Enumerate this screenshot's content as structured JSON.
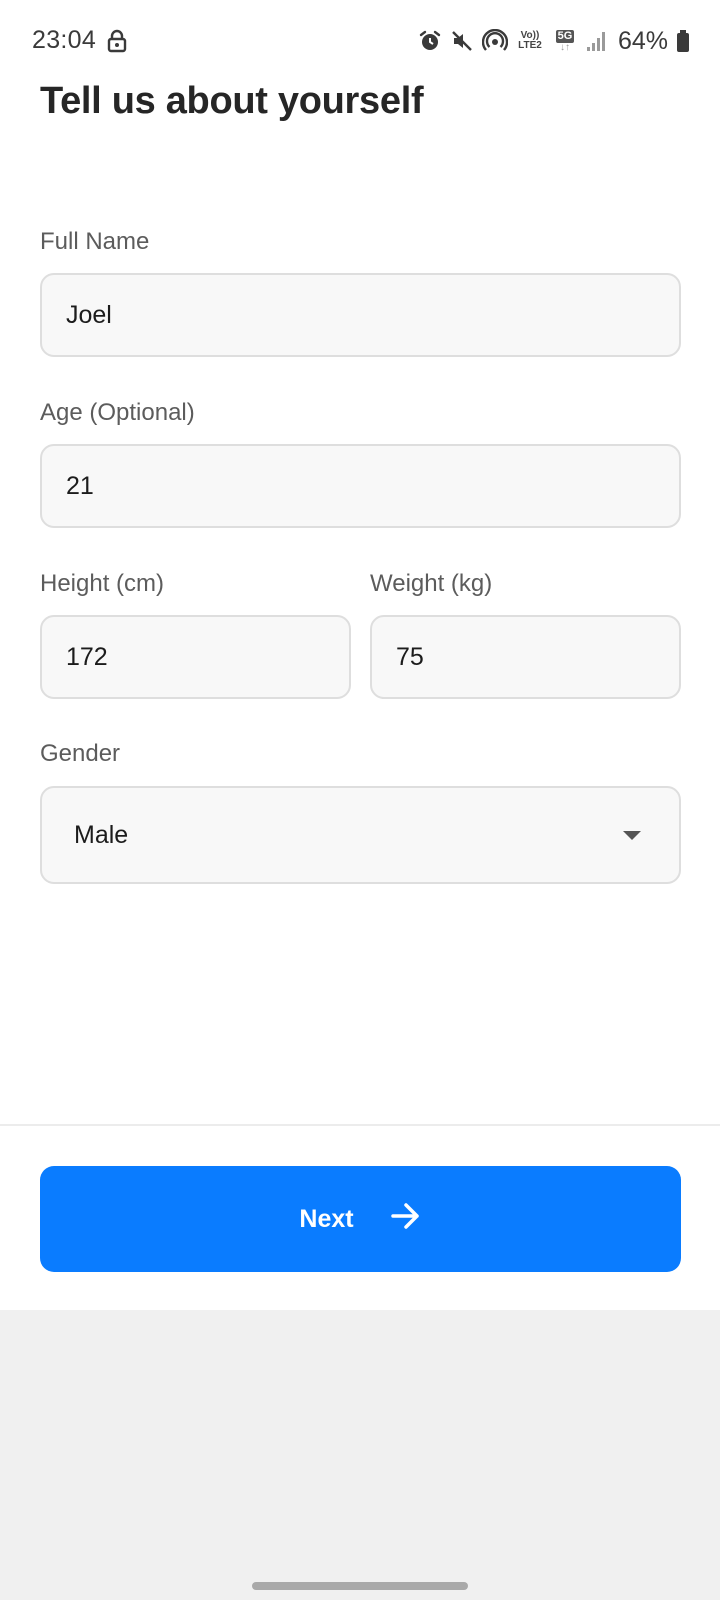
{
  "status_bar": {
    "time": "23:04",
    "network_label_top": "Vo))",
    "network_label_bottom": "LTE2",
    "network_type": "5G",
    "battery": "64%",
    "icons": [
      "lock-icon",
      "alarm-icon",
      "mute-icon",
      "hotspot-icon",
      "signal-icon",
      "battery-icon"
    ]
  },
  "form": {
    "title": "Tell us about yourself",
    "full_name": {
      "label": "Full Name",
      "value": "Joel"
    },
    "age": {
      "label": "Age (Optional)",
      "value": "21"
    },
    "height": {
      "label": "Height (cm)",
      "value": "172"
    },
    "weight": {
      "label": "Weight (kg)",
      "value": "75"
    },
    "gender": {
      "label": "Gender",
      "value": "Male"
    }
  },
  "footer": {
    "next_label": "Next",
    "button_color": "#0a7cff"
  }
}
